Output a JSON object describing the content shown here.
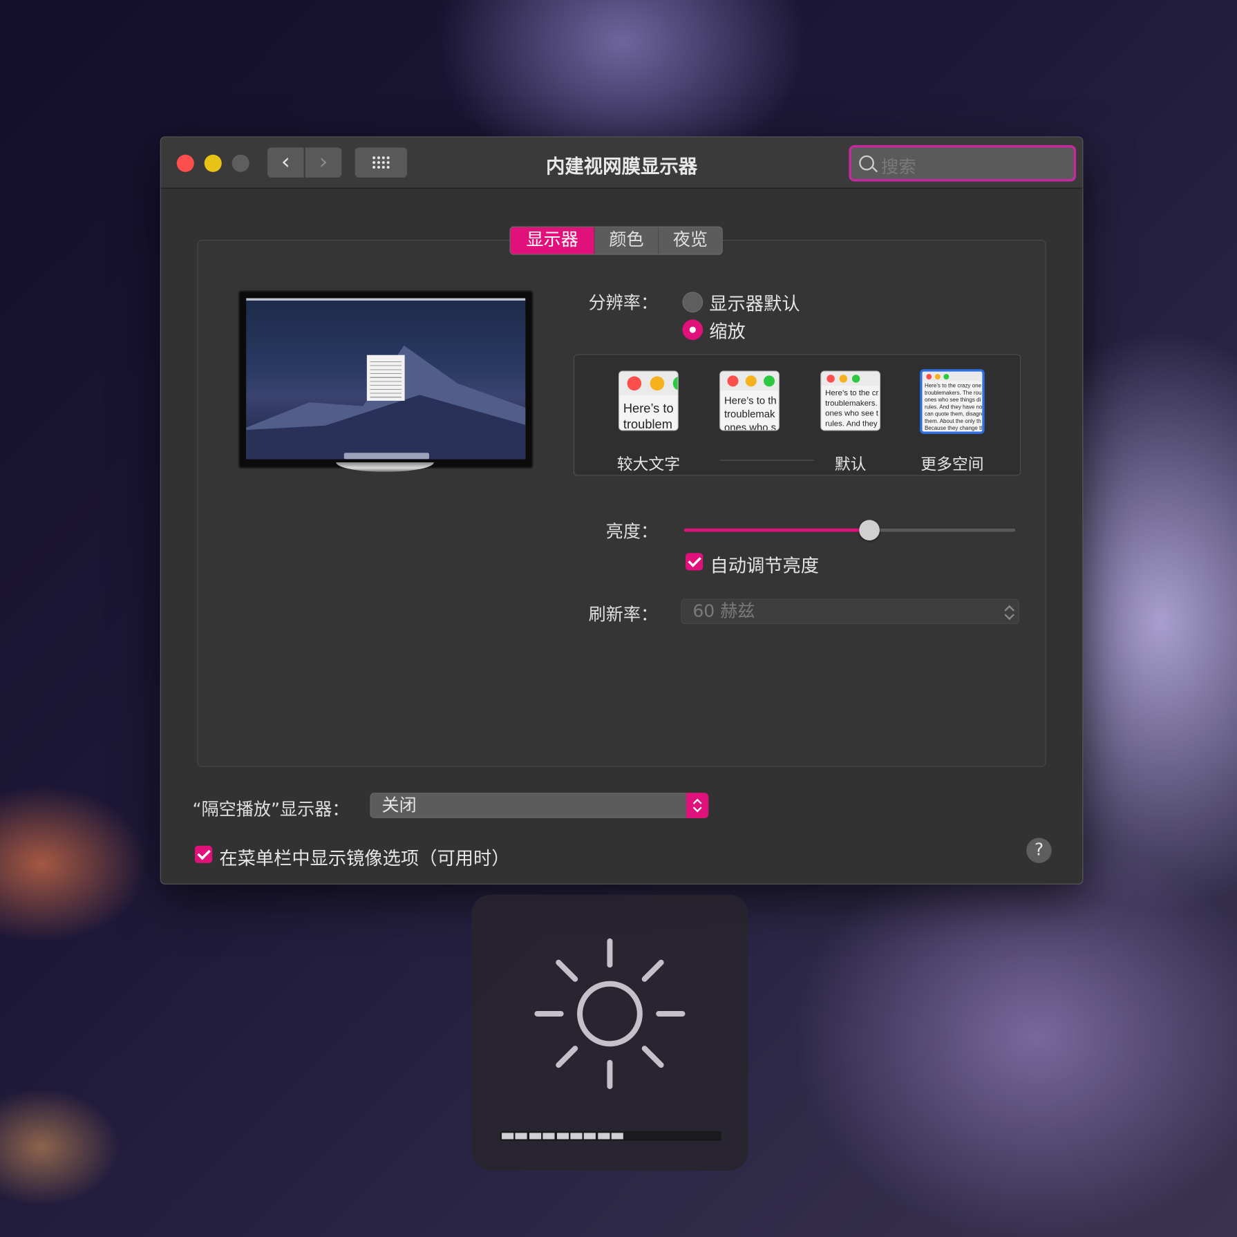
{
  "window": {
    "title": "内建视网膜显示器",
    "search_placeholder": "搜索"
  },
  "tabs": [
    {
      "label": "显示器",
      "active": true
    },
    {
      "label": "颜色",
      "active": false
    },
    {
      "label": "夜览",
      "active": false
    }
  ],
  "resolution": {
    "label": "分辨率：",
    "options": [
      {
        "label": "显示器默认",
        "selected": false
      },
      {
        "label": "缩放",
        "selected": true
      }
    ],
    "scaled_choices": [
      {
        "caption": "较大文字",
        "sample": "Here’s to\ntroublem",
        "selected": false
      },
      {
        "caption": "",
        "sample": "Here’s to th\ntroublemak\nones who s",
        "selected": false
      },
      {
        "caption": "默认",
        "sample": "Here’s to the cr\ntroublemakers.\nones who see t\nrules. And they",
        "selected": false
      },
      {
        "caption": "更多空间",
        "sample": "Here’s to the crazy one\ntroublemakers. The rou\nones who see things di\nrules. And they have no\ncan quote them, disagre\nthem. About the only th\nBecause they change th",
        "selected": true
      }
    ]
  },
  "brightness": {
    "label": "亮度：",
    "level": 0.56,
    "auto_label": "自动调节亮度",
    "auto_checked": true
  },
  "refresh": {
    "label": "刷新率：",
    "value": "60 赫兹"
  },
  "airplay": {
    "label": "“隔空播放”显示器：",
    "value": "关闭"
  },
  "mirroring": {
    "label": "在菜单栏中显示镜像选项（可用时）",
    "checked": true
  },
  "help_label": "?",
  "hud": {
    "icon": "sun-icon",
    "level_segments": 9,
    "total_segments": 16
  },
  "colors": {
    "accent": "#e0117a",
    "search_focus": "#c22a9e",
    "selection_blue": "#2f6fe2"
  }
}
